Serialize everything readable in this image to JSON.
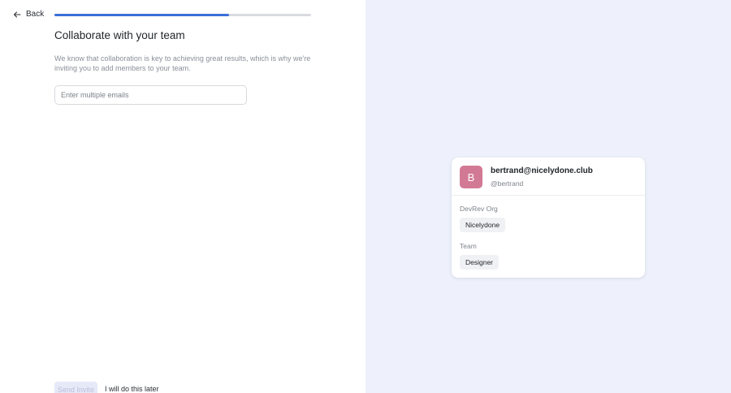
{
  "nav": {
    "back_label": "Back"
  },
  "progress": {
    "fraction": 0.68
  },
  "content": {
    "title": "Collaborate with your team",
    "description": "We know that collaboration is key to achieving great results, which is why we're inviting you to add members to your team."
  },
  "email_input": {
    "value": "",
    "placeholder": "Enter multiple emails"
  },
  "actions": {
    "send_label": "Send Invite",
    "later_label": "I will do this later"
  },
  "profile": {
    "avatar_letter": "B",
    "email": "bertrand@nicelydone.club",
    "handle": "@bertrand",
    "org_label": "DevRev Org",
    "org_value": "Nicelydone",
    "team_label": "Team",
    "team_value": "Designer"
  },
  "colors": {
    "accent": "#3b6fd8",
    "avatar_bg": "#d27a95",
    "right_pane_bg": "#eef1fb"
  }
}
